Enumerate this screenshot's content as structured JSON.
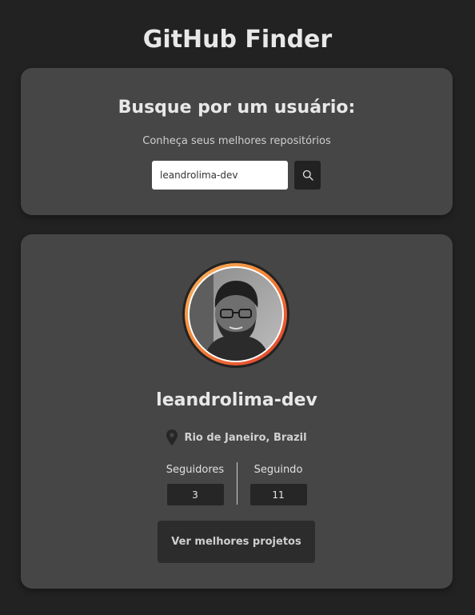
{
  "header": {
    "title": "GitHub Finder"
  },
  "search": {
    "heading": "Busque por um usuário:",
    "subtitle": "Conheça seus melhores repositórios",
    "input_value": "leandrolima-dev",
    "button_icon": "search-icon"
  },
  "profile": {
    "avatar_icon": "user-avatar",
    "username": "leandrolima-dev",
    "location_icon": "map-pin-icon",
    "location": "Rio de Janeiro, Brazil",
    "followers_label": "Seguidores",
    "followers_count": "3",
    "following_label": "Seguindo",
    "following_count": "11",
    "projects_button": "Ver melhores projetos"
  },
  "colors": {
    "background": "#222222",
    "card": "#464646",
    "avatar_gradient_start": "#f7b566",
    "avatar_gradient_end": "#e23a2a"
  }
}
